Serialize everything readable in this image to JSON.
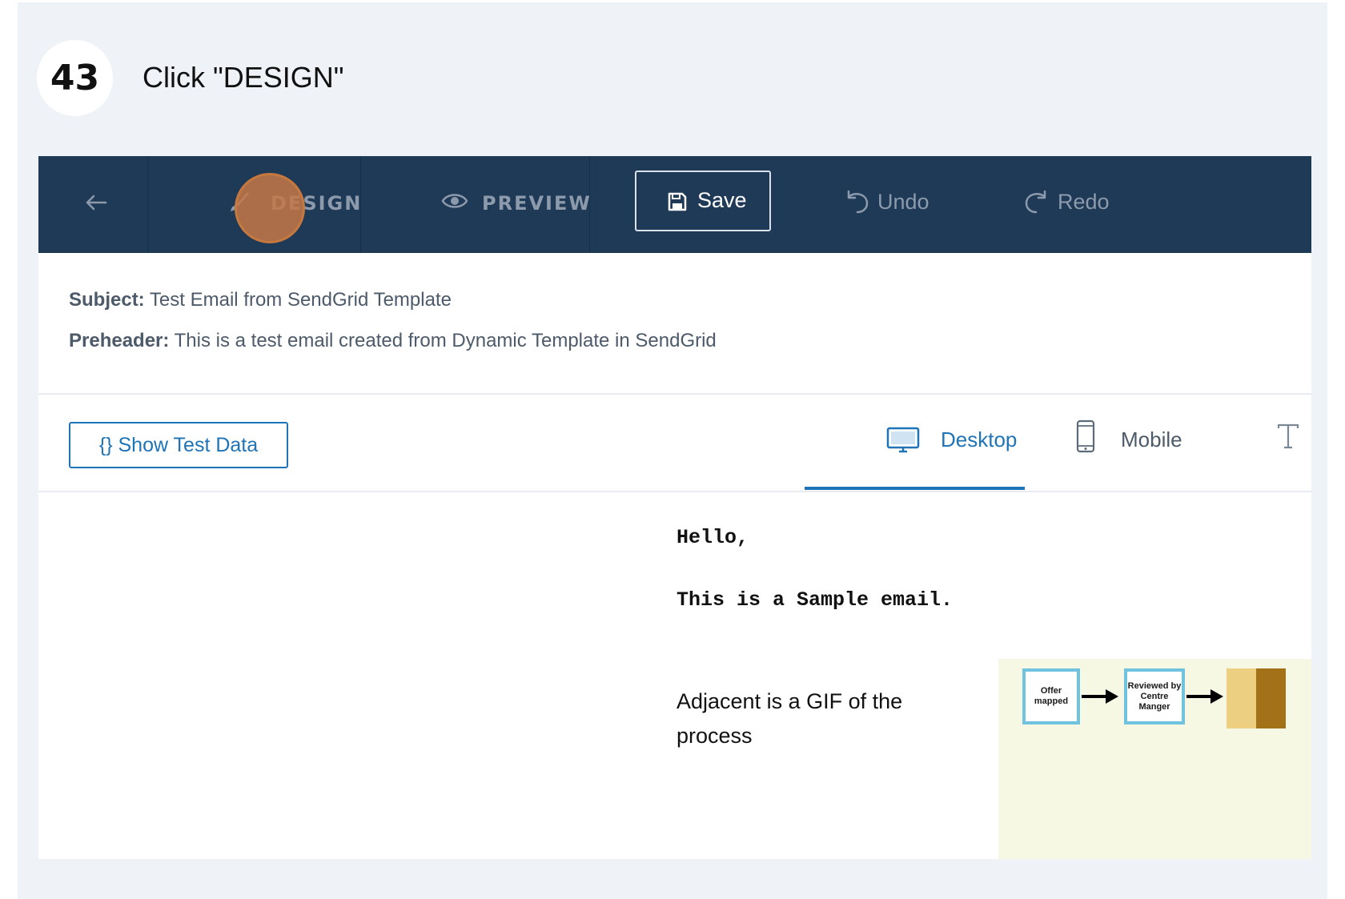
{
  "step": {
    "number": "43",
    "instruction": "Click \"DESIGN\""
  },
  "toolbar": {
    "design_label": "DESIGN",
    "preview_label": "PREVIEW",
    "save_label": "Save",
    "undo_label": "Undo",
    "redo_label": "Redo",
    "icons": [
      "back-arrow-icon",
      "brush-icon",
      "eye-icon",
      "floppy-disk-icon",
      "undo-icon",
      "redo-icon"
    ]
  },
  "meta": {
    "subject_key": "Subject:",
    "subject_value": "Test Email from SendGrid Template",
    "preheader_key": "Preheader:",
    "preheader_value": "This is a test email created from Dynamic Template in SendGrid"
  },
  "viewbar": {
    "show_test_data": "{} Show Test Data",
    "desktop_label": "Desktop",
    "mobile_label": "Mobile",
    "active_tab": "Desktop"
  },
  "email": {
    "greeting": "Hello,",
    "line1": "This is a Sample email.",
    "gif_caption": "Adjacent is a GIF of the process",
    "gif_box1": "Offer mapped",
    "gif_box2": "Reviewed by Centre Manger"
  },
  "colors": {
    "toolbar_bg": "#1f3a57",
    "accent": "#1f73b7",
    "click_marker": "#c7783f",
    "frame_bg": "#eff2f7"
  }
}
